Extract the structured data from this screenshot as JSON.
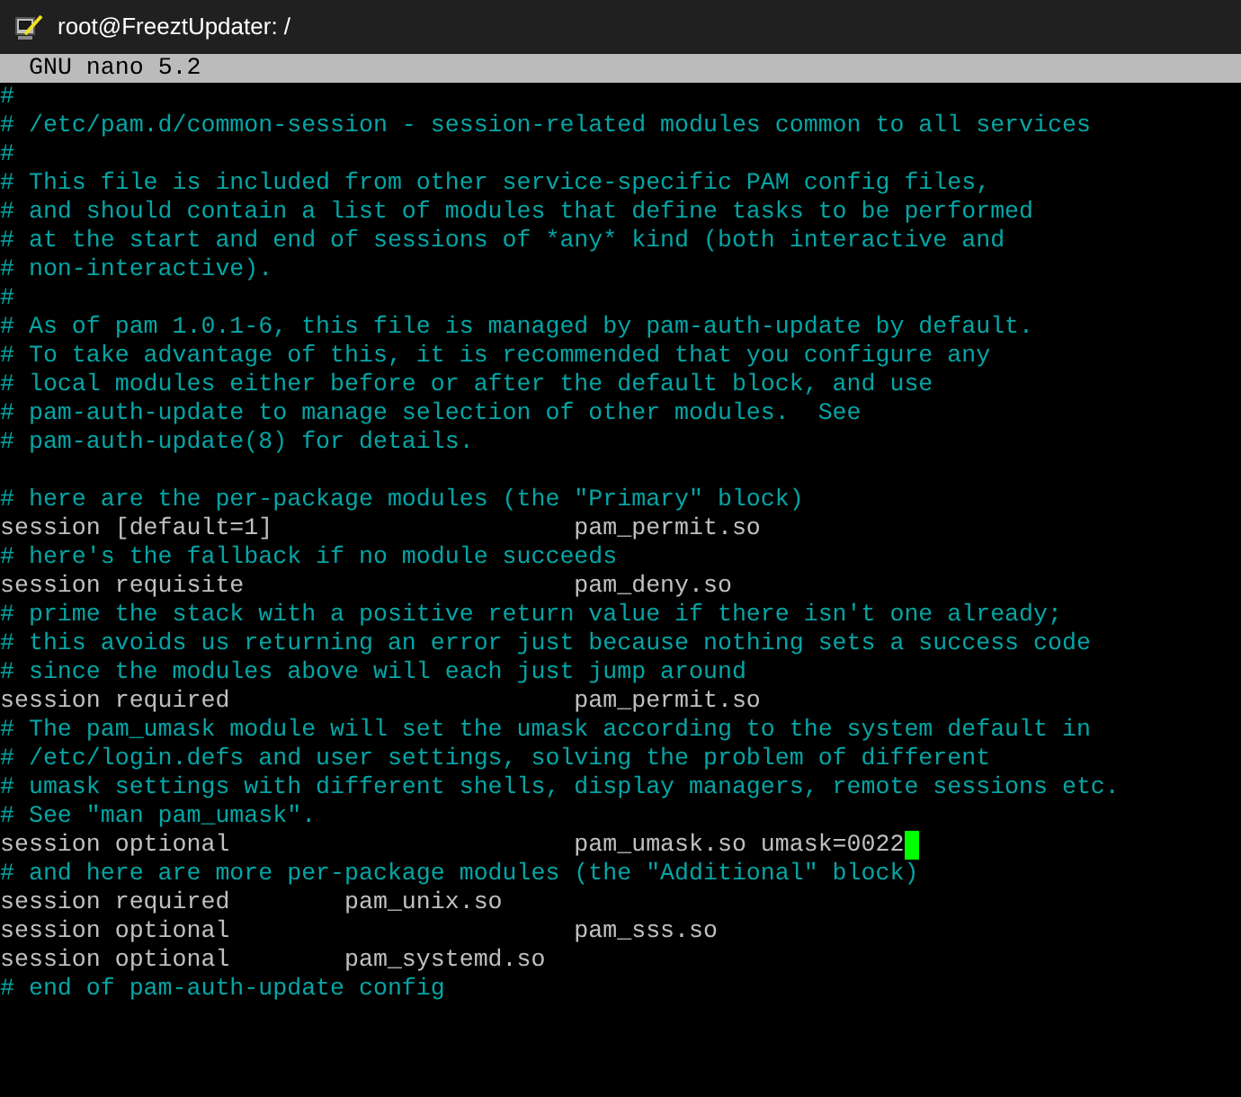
{
  "window": {
    "title": "root@FreeztUpdater: /"
  },
  "editor": {
    "header": "GNU nano 5.2",
    "lines": [
      {
        "kind": "comment",
        "text": "#"
      },
      {
        "kind": "comment",
        "text": "# /etc/pam.d/common-session - session-related modules common to all services"
      },
      {
        "kind": "comment",
        "text": "#"
      },
      {
        "kind": "comment",
        "text": "# This file is included from other service-specific PAM config files,"
      },
      {
        "kind": "comment",
        "text": "# and should contain a list of modules that define tasks to be performed"
      },
      {
        "kind": "comment",
        "text": "# at the start and end of sessions of *any* kind (both interactive and"
      },
      {
        "kind": "comment",
        "text": "# non-interactive)."
      },
      {
        "kind": "comment",
        "text": "#"
      },
      {
        "kind": "comment",
        "text": "# As of pam 1.0.1-6, this file is managed by pam-auth-update by default."
      },
      {
        "kind": "comment",
        "text": "# To take advantage of this, it is recommended that you configure any"
      },
      {
        "kind": "comment",
        "text": "# local modules either before or after the default block, and use"
      },
      {
        "kind": "comment",
        "text": "# pam-auth-update to manage selection of other modules.  See"
      },
      {
        "kind": "comment",
        "text": "# pam-auth-update(8) for details."
      },
      {
        "kind": "blank"
      },
      {
        "kind": "comment",
        "text": "# here are the per-package modules (the \"Primary\" block)"
      },
      {
        "kind": "directive",
        "text": "session [default=1]                     pam_permit.so",
        "cursor": false
      },
      {
        "kind": "comment",
        "text": "# here's the fallback if no module succeeds"
      },
      {
        "kind": "directive",
        "text": "session requisite                       pam_deny.so",
        "cursor": false
      },
      {
        "kind": "comment",
        "text": "# prime the stack with a positive return value if there isn't one already;"
      },
      {
        "kind": "comment",
        "text": "# this avoids us returning an error just because nothing sets a success code"
      },
      {
        "kind": "comment",
        "text": "# since the modules above will each just jump around"
      },
      {
        "kind": "directive",
        "text": "session required                        pam_permit.so",
        "cursor": false
      },
      {
        "kind": "comment",
        "text": "# The pam_umask module will set the umask according to the system default in"
      },
      {
        "kind": "comment",
        "text": "# /etc/login.defs and user settings, solving the problem of different"
      },
      {
        "kind": "comment",
        "text": "# umask settings with different shells, display managers, remote sessions etc."
      },
      {
        "kind": "comment",
        "text": "# See \"man pam_umask\"."
      },
      {
        "kind": "directive",
        "text": "session optional                        pam_umask.so umask=0022",
        "cursor": true
      },
      {
        "kind": "comment",
        "text": "# and here are more per-package modules (the \"Additional\" block)"
      },
      {
        "kind": "directive",
        "text": "session required        pam_unix.so",
        "cursor": false
      },
      {
        "kind": "directive",
        "text": "session optional                        pam_sss.so",
        "cursor": false
      },
      {
        "kind": "directive",
        "text": "session optional        pam_systemd.so",
        "cursor": false
      },
      {
        "kind": "comment",
        "text": "# end of pam-auth-update config"
      }
    ]
  }
}
